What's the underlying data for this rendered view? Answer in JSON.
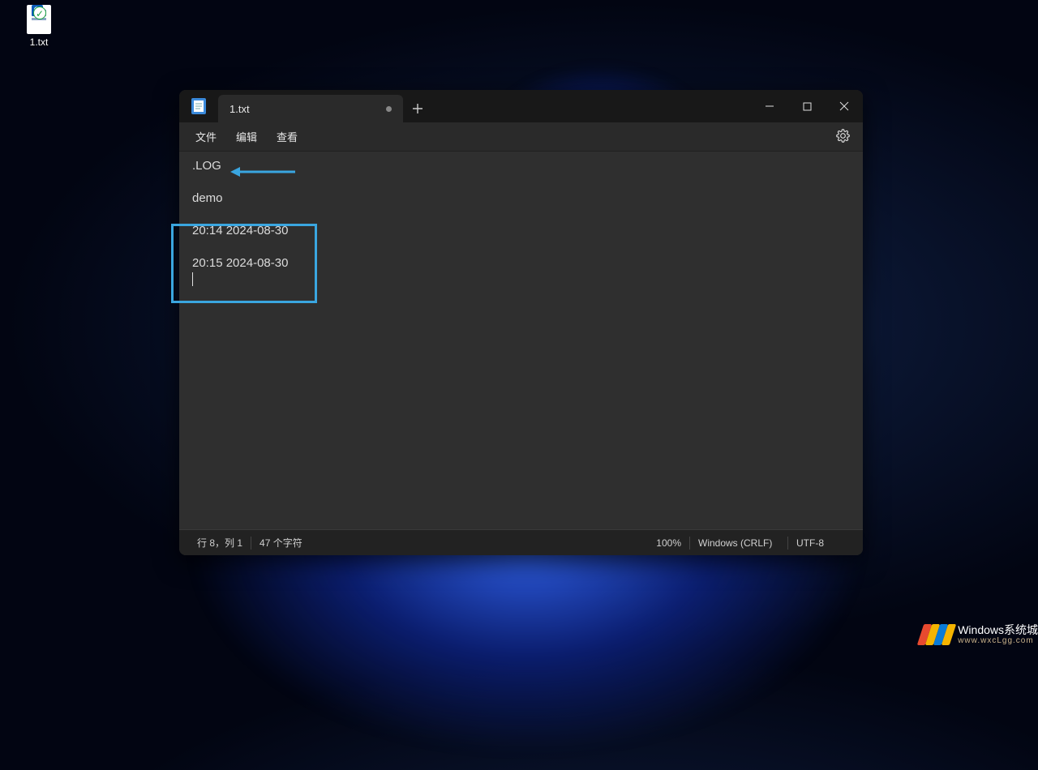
{
  "desktop": {
    "icon_label": "1.txt"
  },
  "window": {
    "tab_title": "1.txt",
    "menus": {
      "file": "文件",
      "edit": "编辑",
      "view": "查看"
    },
    "editor_lines": [
      ".LOG",
      "",
      "demo",
      "",
      "20:14 2024-08-30",
      "",
      "20:15 2024-08-30"
    ],
    "status": {
      "position": "行 8，列 1",
      "chars": "47 个字符",
      "zoom": "100%",
      "eol": "Windows (CRLF)",
      "encoding": "UTF-8"
    }
  },
  "watermark": {
    "title": "Windows系统城",
    "url": "www.wxcLgg.com"
  }
}
